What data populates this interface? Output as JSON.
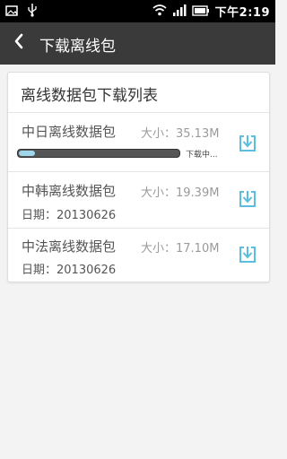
{
  "status_bar": {
    "time": "下午2:19",
    "icons": [
      "photo-notification-icon",
      "usb-icon",
      "wifi-icon",
      "signal-icon",
      "battery-icon"
    ]
  },
  "app_bar": {
    "back_icon": "chevron-left-icon",
    "title": "下载离线包"
  },
  "panel": {
    "title": "离线数据包下载列表",
    "items": [
      {
        "name": "中日离线数据包",
        "size": "大小：35.13M",
        "status": "下载中...",
        "progress_fraction": 0.1,
        "action_icon": "download-icon"
      },
      {
        "name": "中韩离线数据包",
        "size": "大小：19.39M",
        "date": "日期：20130626",
        "action_icon": "download-icon"
      },
      {
        "name": "中法离线数据包",
        "size": "大小：17.10M",
        "date": "日期：20130626",
        "action_icon": "download-icon"
      }
    ]
  },
  "colors": {
    "status_bar_bg": "#000000",
    "app_bar_bg": "#3a3a3a",
    "accent": "#5bbde0",
    "progress_fill": "#9fd6ea"
  }
}
